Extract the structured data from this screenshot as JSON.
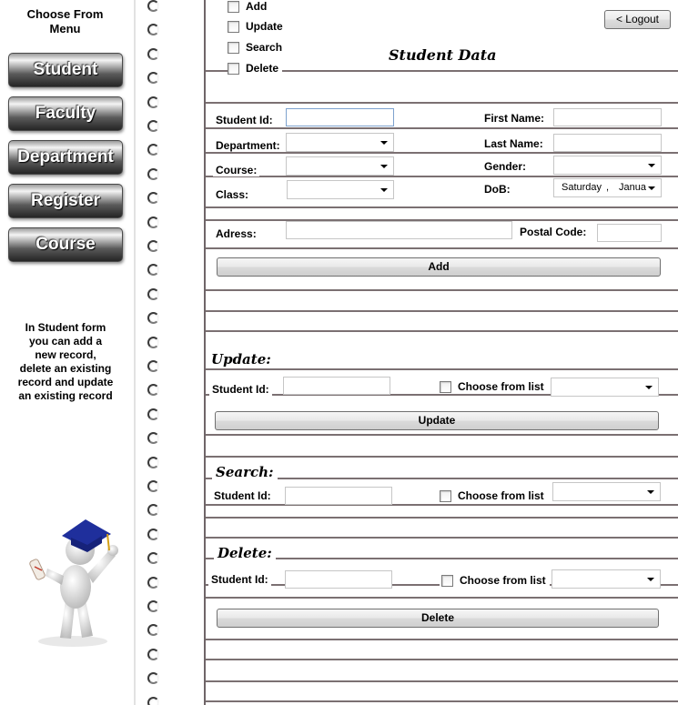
{
  "sidebar": {
    "title": "Choose From\nMenu",
    "menu": [
      "Student",
      "Faculty",
      "Department",
      "Register",
      "Course"
    ],
    "info": "In Student form\nyou can add a\nnew record,\ndelete an existing\nrecord and update\nan existing record"
  },
  "header": {
    "logout_label": "< Logout",
    "title": "Student Data",
    "options": [
      "Add",
      "Update",
      "Search",
      "Delete"
    ]
  },
  "form": {
    "student_id_label": "Student Id:",
    "first_name_label": "First Name:",
    "department_label": "Department:",
    "last_name_label": "Last Name:",
    "course_label": "Course:",
    "gender_label": "Gender:",
    "class_label": "Class:",
    "dob_label": "DoB:",
    "dob_day": "Saturday",
    "dob_sep": ",",
    "dob_month": "Janua",
    "address_label": "Adress:",
    "postal_code_label": "Postal Code:",
    "add_button": "Add"
  },
  "update": {
    "title": "Update:",
    "student_id_label": "Student Id:",
    "choose_label": "Choose from list",
    "button": "Update"
  },
  "search": {
    "title": "Search:",
    "student_id_label": "Student Id:",
    "choose_label": "Choose from list"
  },
  "delete": {
    "title": "Delete:",
    "student_id_label": "Student Id:",
    "choose_label": "Choose from list",
    "button": "Delete"
  }
}
